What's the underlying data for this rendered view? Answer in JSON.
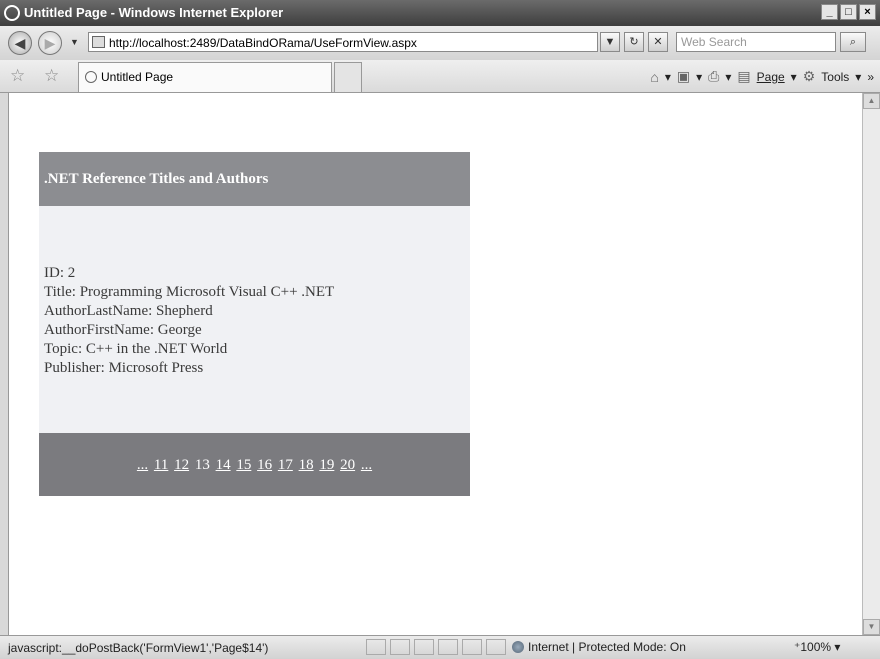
{
  "window": {
    "title": "Untitled Page - Windows Internet Explorer"
  },
  "addressbar": {
    "url": "http://localhost:2489/DataBindORama/UseFormView.aspx",
    "search_placeholder": "Web Search"
  },
  "tab": {
    "title": "Untitled Page"
  },
  "commandbar": {
    "page_label": "Page",
    "tools_label": "Tools"
  },
  "formview": {
    "header": ".NET Reference Titles and Authors",
    "fields": [
      "ID: 2",
      "Title: Programming Microsoft Visual C++ .NET",
      "AuthorLastName: Shepherd",
      "AuthorFirstName: George",
      "Topic: C++ in the .NET World",
      "Publisher: Microsoft Press"
    ],
    "pager": {
      "prev": "...",
      "pages": [
        "11",
        "12",
        "13",
        "14",
        "15",
        "16",
        "17",
        "18",
        "19",
        "20"
      ],
      "current": "13",
      "next": "..."
    }
  },
  "statusbar": {
    "text": "javascript:__doPostBack('FormView1','Page$14')",
    "zone": "Internet | Protected Mode: On",
    "zoom": "100%"
  }
}
